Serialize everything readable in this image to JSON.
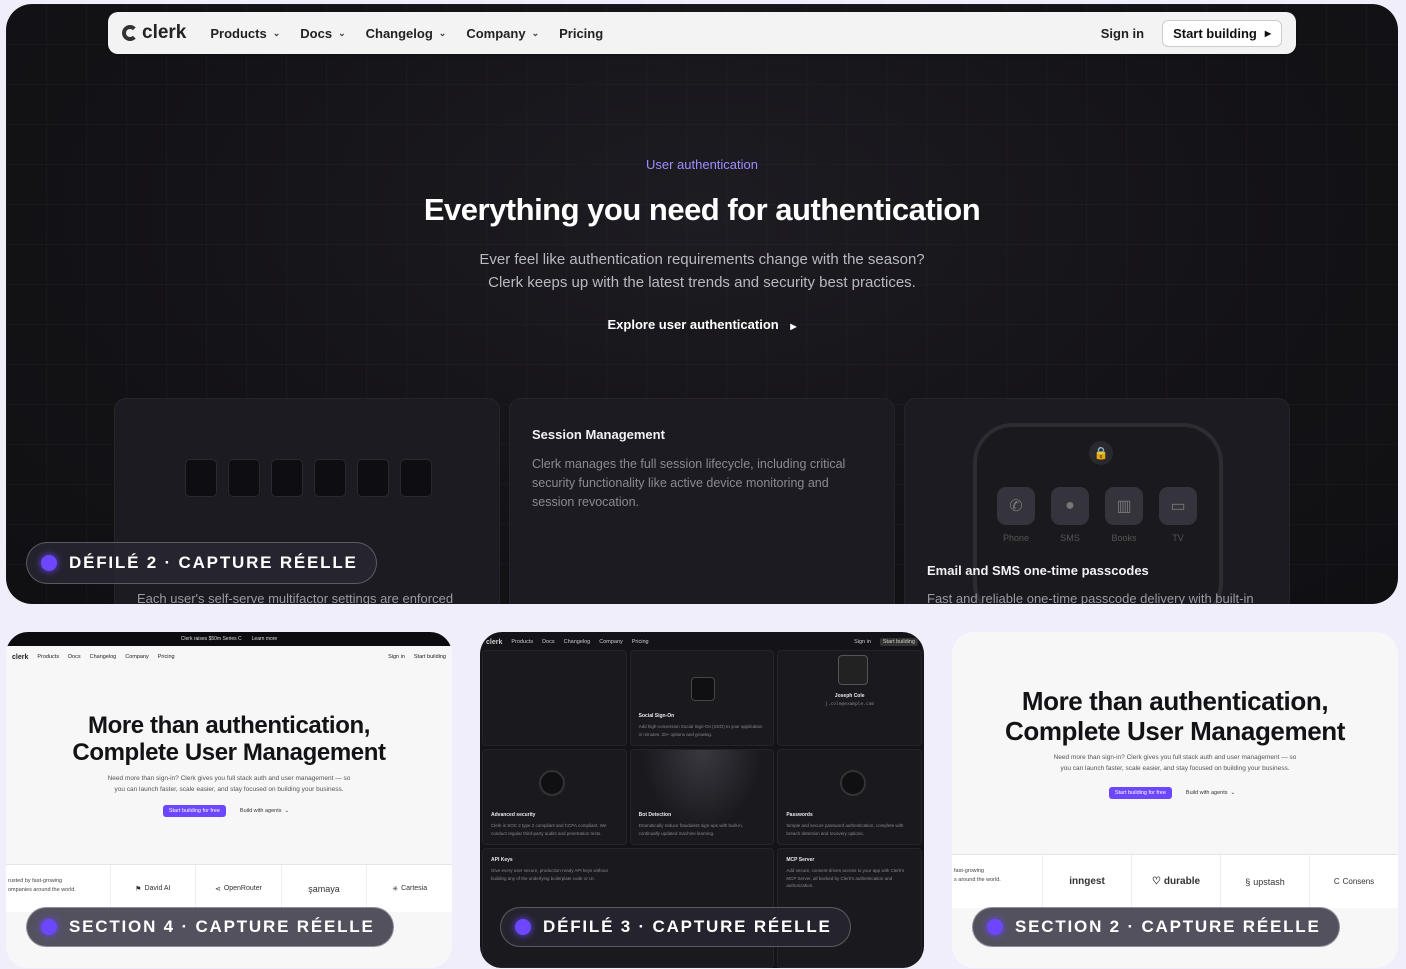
{
  "nav": {
    "logo": "clerk",
    "items": [
      "Products",
      "Docs",
      "Changelog",
      "Company",
      "Pricing"
    ],
    "sign_in": "Sign in",
    "start": "Start building"
  },
  "hero": {
    "eyebrow": "User authentication",
    "title": "Everything you need for authentication",
    "sub1": "Ever feel like authentication requirements change with the season?",
    "sub2": "Clerk keeps up with the latest trends and security best practices.",
    "link": "Explore user authentication"
  },
  "cards": {
    "mfa_text": "Each user's self-serve multifactor settings are enforced",
    "session_title": "Session Management",
    "session_text1": "Clerk manages the full session lifecycle, including critical",
    "session_text2": "security functionality like active device monitoring and",
    "session_text3": "session revocation.",
    "otp_title": "Email and SMS one-time passcodes",
    "otp_text": "Fast and reliable one-time passcode delivery with built-in",
    "apps": [
      "Phone",
      "SMS",
      "Books",
      "TV"
    ]
  },
  "badges": {
    "main": "DÉFILÉ 2 · CAPTURE RÉELLE",
    "left": "SECTION 4 · CAPTURE RÉELLE",
    "middle": "DÉFILÉ 3 · CAPTURE RÉELLE",
    "right": "SECTION 2 · CAPTURE RÉELLE"
  },
  "thumb_left": {
    "banner": "Clerk raises $50m Series C",
    "banner_link": "Learn more",
    "title1": "More than authentication,",
    "title2": "Complete User Management",
    "sub1": "Need more than sign-in? Clerk gives you full stack auth and user management — so",
    "sub2": "you can launch faster, scale easier, and stay focused on building your business.",
    "btn1": "Start building for free",
    "btn2": "Build with agents",
    "intro1": "rusted by fast-growing",
    "intro2": "ompanies around the world.",
    "logos": [
      "David AI",
      "OpenRouter",
      "şamaya",
      "Cartesia"
    ]
  },
  "thumb_mid": {
    "sso_title": "Social Sign-On",
    "sso_text": "Add high-conversion Social Sign-On (SSO) to your application in minutes. 20+ options and growing.",
    "user_name": "Joseph Cole",
    "user_email": "j.cole@example.com",
    "adv_title": "Advanced security",
    "adv_text": "Clerk is SOC 2 type 2 compliant and CCPA compliant. We conduct regular third-party audits and penetration tests.",
    "bot_title": "Bot Detection",
    "bot_text": "Dramatically reduce fraudulent sign-ups with built-in, continually updated machine learning.",
    "pw_title": "Passwords",
    "pw_text": "Simple and secure password authentication, complete with breach detection and recovery options.",
    "api_title": "API Keys",
    "api_text": "Give every user secure, production-ready API keys without building any of the underlying boilerplate code or UI.",
    "mcp_title": "MCP Server",
    "mcp_text": "Add secure, consent-driven access to your app with Clerk's MCP Server, all backed by Clerk's authentication and authorization."
  },
  "thumb_right": {
    "title1": "More than authentication,",
    "title2": "Complete User Management",
    "sub1": "Need more than sign-in? Clerk gives you full stack auth and user management — so",
    "sub2": "you can launch faster, scale easier, and stay focused on building your business.",
    "btn1": "Start building for free",
    "btn2": "Build with agents",
    "intro1": "fast-growing",
    "intro2": "s around the world.",
    "logos": [
      "inngest",
      "durable",
      "upstash",
      "Consens"
    ]
  },
  "colors": {
    "accent": "#6c47ff",
    "eyebrow": "#9f8cff"
  }
}
